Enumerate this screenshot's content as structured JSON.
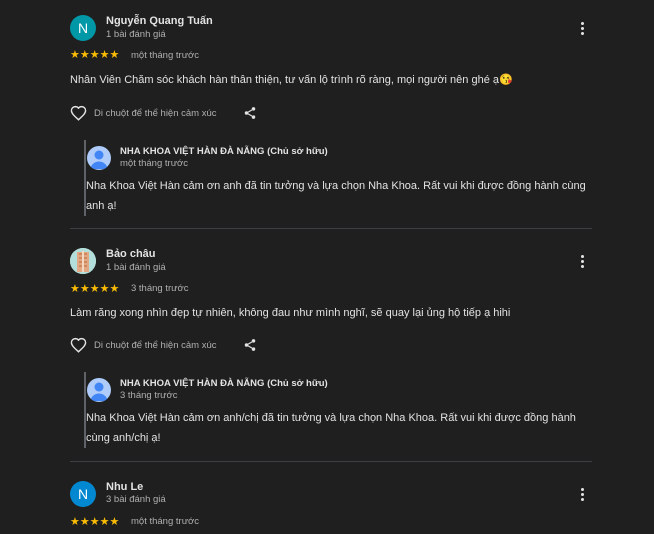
{
  "reviews": [
    {
      "avatar_letter": "N",
      "avatar_color": "#0097a7",
      "name": "Nguyễn Quang Tuấn",
      "count": "1 bài đánh giá",
      "stars": "★★★★★",
      "time": "một tháng trước",
      "text": "Nhân Viên Chăm sóc khách hàn thân thiện, tư vấn lộ trình rõ ràng, mọi người nên ghé ạ😘",
      "reaction_label": "Di chuột để thể hiện cảm xúc",
      "reply": {
        "owner": "NHA KHOA VIỆT HÀN ĐÀ NẴNG (Chủ sở hữu)",
        "time": "một tháng trước",
        "text": "Nha Khoa Việt Hàn cảm ơn anh đã tin tưởng và lựa chọn Nha Khoa. Rất vui khi được đồng hành cùng anh ạ!"
      }
    },
    {
      "avatar_letter": "",
      "avatar_color": "#a5d6a7",
      "name": "Bảo châu",
      "count": "1 bài đánh giá",
      "stars": "★★★★★",
      "time": "3 tháng trước",
      "text": "Làm răng xong nhìn đẹp tự nhiên, không đau như mình nghĩ, sẽ quay lại ủng hộ tiếp ạ hihi",
      "reaction_label": "Di chuột để thể hiện cảm xúc",
      "reply": {
        "owner": "NHA KHOA VIỆT HÀN ĐÀ NẴNG (Chủ sở hữu)",
        "time": "3 tháng trước",
        "text": "Nha Khoa Việt Hàn cảm ơn anh/chị đã tin tưởng và lựa chọn Nha Khoa. Rất vui khi được đồng hành cùng anh/chị ạ!"
      }
    },
    {
      "avatar_letter": "N",
      "avatar_color": "#0288d1",
      "name": "Nhu Le",
      "count": "3 bài đánh giá",
      "stars": "★★★★★",
      "time": "một tháng trước"
    }
  ]
}
